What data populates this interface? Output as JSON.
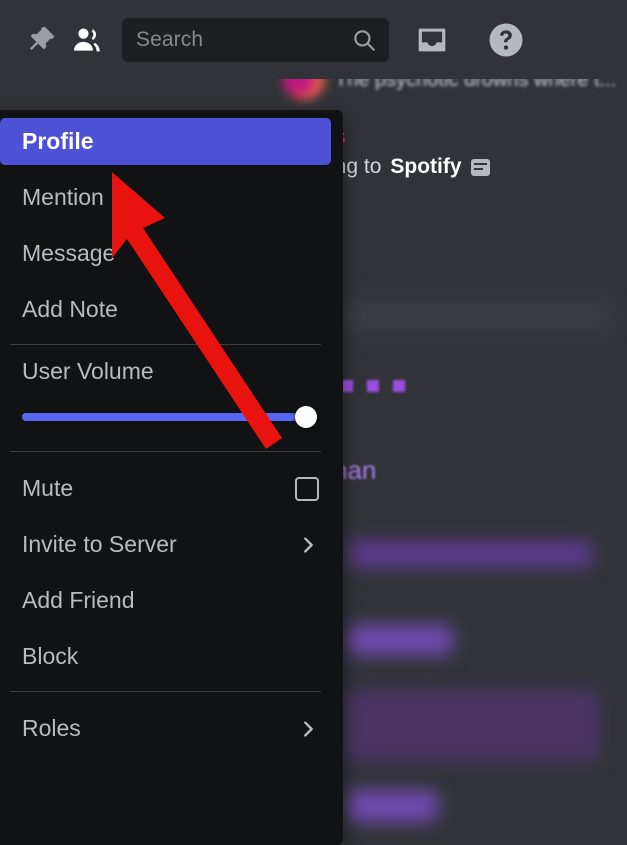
{
  "toolbar": {
    "pin_icon": "pin-icon",
    "members_icon": "members-icon",
    "inbox_icon": "inbox-icon",
    "help_icon": "help-icon",
    "search": {
      "placeholder": "Search",
      "value": "",
      "icon": "search-icon"
    }
  },
  "background": {
    "message_preview": "The psychotic drowns where t...",
    "status_name": "s",
    "status_prefix": "ing to",
    "status_app": "Spotify",
    "status_badge_icon": "spotify-status-icon",
    "member_fragment": "nan"
  },
  "context_menu": {
    "items": [
      {
        "label": "Profile",
        "name": "profile",
        "selected": true,
        "chevron": false
      },
      {
        "label": "Mention",
        "name": "mention",
        "selected": false,
        "chevron": false
      },
      {
        "label": "Message",
        "name": "message",
        "selected": false,
        "chevron": false
      },
      {
        "label": "Add Note",
        "name": "add-note",
        "selected": false,
        "chevron": false
      }
    ],
    "volume": {
      "label": "User Volume",
      "value": 100,
      "min": 0,
      "max": 100
    },
    "mute": {
      "label": "Mute",
      "checked": false
    },
    "items_lower": [
      {
        "label": "Invite to Server",
        "name": "invite-to-server",
        "chevron": true
      },
      {
        "label": "Add Friend",
        "name": "add-friend",
        "chevron": false
      },
      {
        "label": "Block",
        "name": "block",
        "chevron": false
      }
    ],
    "items_roles": [
      {
        "label": "Roles",
        "name": "roles",
        "chevron": true
      }
    ]
  },
  "annotation": {
    "arrow_color": "#e8120f",
    "arrow_icon": "red-pointer-arrow"
  },
  "colors": {
    "accent": "#4d51d6",
    "slider": "#5865f2",
    "menu_bg": "#111214",
    "app_bg": "#313338"
  }
}
